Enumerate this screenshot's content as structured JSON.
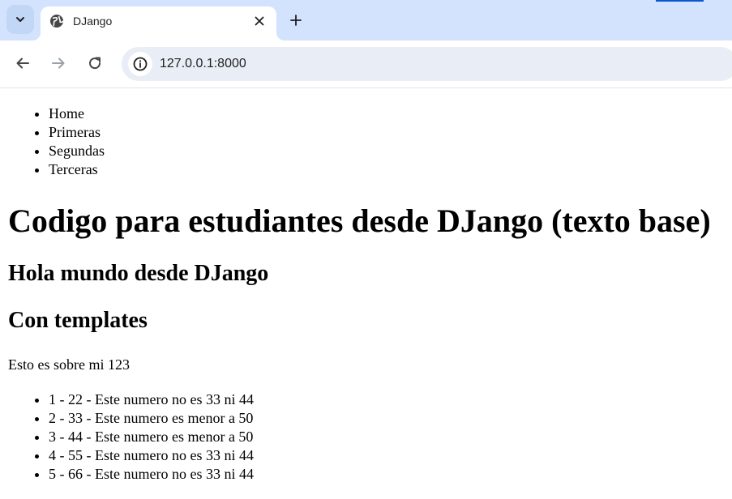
{
  "browser": {
    "tab_title": "DJango",
    "url": "127.0.0.1:8000",
    "icons": {
      "tab_search": "chevron-down-icon",
      "favicon": "globe-icon",
      "close": "close-icon",
      "new_tab": "plus-icon",
      "back": "arrow-left-icon",
      "forward": "arrow-right-icon",
      "reload": "reload-icon",
      "site_info": "info-icon"
    },
    "colors": {
      "tabstrip": "#d3e3fd",
      "omnibox": "#e9eef6",
      "accent": "#0b57d0"
    }
  },
  "page": {
    "nav_items": [
      "Home",
      "Primeras",
      "Segundas",
      "Terceras"
    ],
    "title": "Codigo para estudiantes desde DJango (texto base)",
    "greeting": "Hola mundo desde DJango",
    "subtitle": "Con templates",
    "intro": "Esto es sobre mi 123",
    "numbers": [
      "1 - 22 - Este numero no es 33 ni 44",
      "2 - 33 - Este numero es menor a 50",
      "3 - 44 - Este numero es menor a 50",
      "4 - 55 - Este numero no es 33 ni 44",
      "5 - 66 - Este numero no es 33 ni 44"
    ]
  }
}
